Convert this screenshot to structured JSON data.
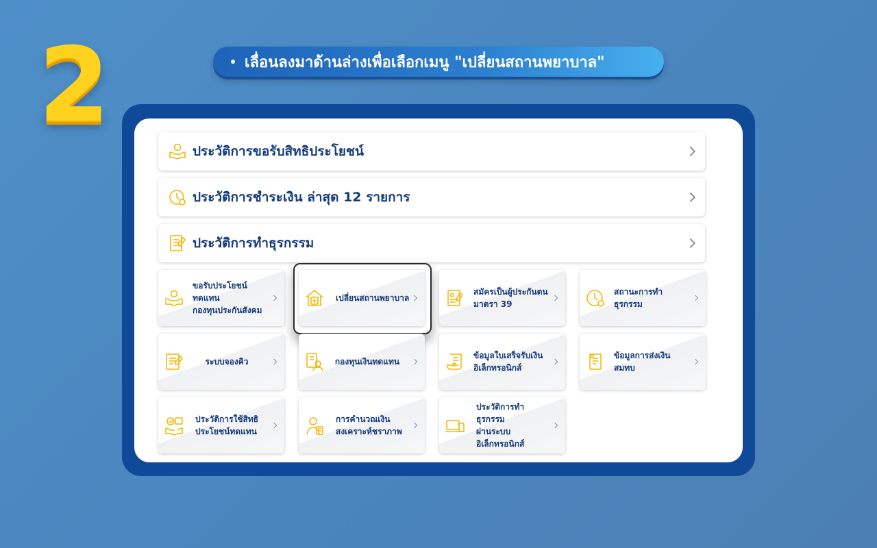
{
  "step": {
    "number": "2"
  },
  "instruction": {
    "text": "เลื่อนลงมาด้านล่างเพื่อเลือกเมนู \"เปลี่ยนสถานพยาบาล\""
  },
  "colors": {
    "accent_yellow": "#f5b400",
    "brand_blue": "#0f4a99",
    "text_navy": "#143a7a"
  },
  "list_rows": [
    {
      "label": "ประวัติการขอรับสิทธิประโยชน์",
      "icon": "hands-coin-icon"
    },
    {
      "label": "ประวัติการชำระเงิน ล่าสุด 12 รายการ",
      "icon": "clock-coin-icon"
    },
    {
      "label": "ประวัติการทำธุรกรรม",
      "icon": "document-pen-icon"
    }
  ],
  "tiles": [
    {
      "label": "ขอรับประโยชน์ทดแทน\nกองทุนประกันสังคม",
      "icon": "hands-coin-icon"
    },
    {
      "label": "เปลี่ยนสถานพยาบาล",
      "icon": "hospital-icon",
      "highlighted": true
    },
    {
      "label": "สมัครเป็นผู้ประกันตน\nมาตรา 39",
      "icon": "form-id-icon"
    },
    {
      "label": "สถานะการทำธุรกรรม",
      "icon": "clock-icon"
    },
    {
      "label": "ระบบจองคิว",
      "icon": "queue-document-icon"
    },
    {
      "label": "กองทุนเงินทดแทน",
      "icon": "worker-fund-icon"
    },
    {
      "label": "ข้อมูลใบเสร็จรับเงิน\nอิเล็กทรอนิกส์",
      "icon": "receipt-scroll-icon"
    },
    {
      "label": "ข้อมูลการส่งเงิน\nสมทบ",
      "icon": "contribution-document-icon"
    },
    {
      "label": "ประวัติการใช้สิทธิ\nประโยชน์ทดแทน",
      "icon": "benefit-history-icon"
    },
    {
      "label": "การคำนวณเงิน\nสงเคราะห์ชราภาพ",
      "icon": "elderly-calc-icon"
    },
    {
      "label": "ประวัติการทำธุรกรรม\nผ่านระบบ\nอิเล็กทรอนิกส์",
      "icon": "devices-icon"
    }
  ]
}
